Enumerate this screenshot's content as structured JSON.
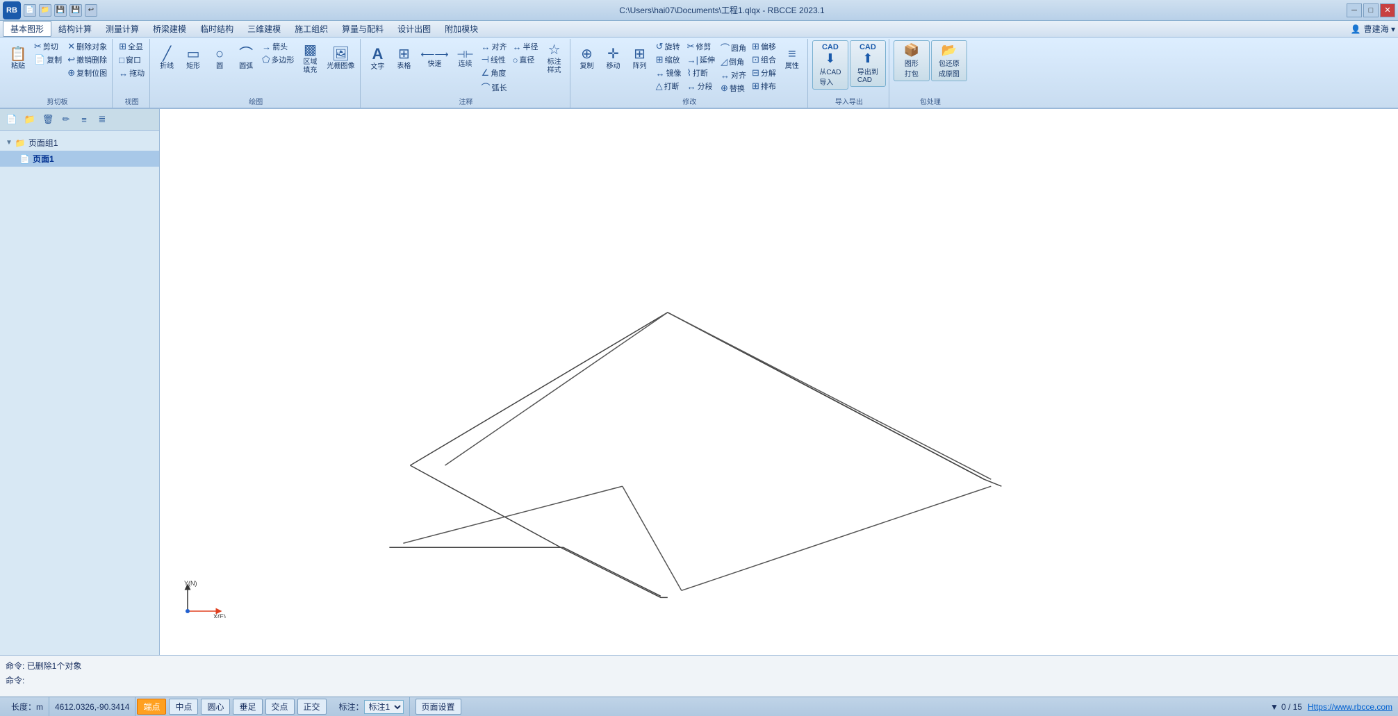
{
  "titlebar": {
    "title": "C:\\Users\\hai07\\Documents\\工程1.qlqx - RBCCE 2023.1",
    "app_name": "RB",
    "minimize": "─",
    "restore": "□",
    "close": "✕"
  },
  "menubar": {
    "items": [
      "基本图形",
      "结构计算",
      "测量计算",
      "桥梁建模",
      "临时结构",
      "三维建模",
      "施工组织",
      "算量与配料",
      "设计出图",
      "附加模块"
    ],
    "active_item": 0,
    "user": "曹建海 ▾"
  },
  "ribbon": {
    "groups": [
      {
        "label": "剪切板",
        "buttons": [
          {
            "icon": "📋",
            "label": "粘贴",
            "type": "big"
          },
          {
            "col": [
              {
                "icon": "✂",
                "label": "剪切"
              },
              {
                "icon": "📄",
                "label": "复制"
              }
            ]
          },
          {
            "col": [
              {
                "icon": "↩",
                "label": "删除对象"
              },
              {
                "icon": "↪",
                "label": "撤销删除"
              },
              {
                "icon": "⊕",
                "label": "复制位图"
              }
            ]
          }
        ]
      },
      {
        "label": "视图",
        "buttons": [
          {
            "col": [
              {
                "icon": "⊞",
                "label": "全显"
              },
              {
                "icon": "□",
                "label": "窗口"
              },
              {
                "icon": "↔",
                "label": "拖动"
              }
            ]
          }
        ]
      },
      {
        "label": "绘图",
        "buttons": [
          {
            "icon": "╱",
            "label": "折线",
            "type": "big"
          },
          {
            "icon": "□",
            "label": "矩形",
            "type": "big"
          },
          {
            "icon": "○",
            "label": "圆",
            "type": "big"
          },
          {
            "icon": "⌒",
            "label": "圆弧",
            "type": "big"
          },
          {
            "col": [
              {
                "icon": "→",
                "label": "箭头"
              },
              {
                "icon": "⬠",
                "label": "多边形"
              }
            ]
          },
          {
            "icon": "▩",
            "label": "区域填充",
            "type": "big"
          },
          {
            "icon": "🖼",
            "label": "光栅图像",
            "type": "big"
          }
        ]
      },
      {
        "label": "注释",
        "buttons": [
          {
            "icon": "A",
            "label": "文字",
            "type": "big"
          },
          {
            "icon": "⊞",
            "label": "表格",
            "type": "big"
          },
          {
            "icon": "⟵⟶",
            "label": "快速",
            "type": "big"
          },
          {
            "icon": "⊣⊢",
            "label": "连续",
            "type": "big"
          },
          {
            "col": [
              {
                "icon": "↔",
                "label": "对齐"
              },
              {
                "icon": "⊣",
                "label": "线性"
              },
              {
                "icon": "∠",
                "label": "角度"
              },
              {
                "icon": "⌒",
                "label": "弧长"
              }
            ]
          },
          {
            "col": [
              {
                "icon": "↔",
                "label": "半径"
              },
              {
                "icon": "○",
                "label": "直径"
              }
            ]
          },
          {
            "icon": "☆",
            "label": "标注样式",
            "type": "big"
          }
        ]
      },
      {
        "label": "修改",
        "buttons": [
          {
            "icon": "⊕",
            "label": "复制",
            "type": "big"
          },
          {
            "icon": "↔",
            "label": "移动",
            "type": "big"
          },
          {
            "icon": "⊞",
            "label": "阵列",
            "type": "big"
          },
          {
            "col": [
              {
                "icon": "↺",
                "label": "旋转"
              },
              {
                "icon": "⊞",
                "label": "缩放"
              },
              {
                "icon": "↔",
                "label": "镜像"
              },
              {
                "icon": "△",
                "label": "打断"
              }
            ]
          },
          {
            "col": [
              {
                "icon": "✂",
                "label": "修剪"
              },
              {
                "icon": "→|",
                "label": "延伸"
              },
              {
                "icon": "△",
                "label": "打断"
              },
              {
                "icon": "↔",
                "label": "分段"
              }
            ]
          },
          {
            "col": [
              {
                "icon": "⌒",
                "label": "圆角"
              },
              {
                "icon": "◿",
                "label": "倒角"
              },
              {
                "icon": "↔",
                "label": "对齐"
              },
              {
                "icon": "⊕",
                "label": "替换"
              }
            ]
          },
          {
            "col": [
              {
                "icon": "⊞",
                "label": "偏移"
              },
              {
                "icon": "⊡",
                "label": "组合"
              },
              {
                "icon": "⊟",
                "label": "分解"
              },
              {
                "icon": "⊞",
                "label": "排布"
              }
            ]
          },
          {
            "icon": "≡",
            "label": "属性",
            "type": "big"
          }
        ]
      },
      {
        "label": "导入导出",
        "buttons": [
          {
            "icon": "CAD\n导入",
            "label": "从CAD\n导入",
            "type": "cad"
          },
          {
            "icon": "CAD\n导出",
            "label": "导出到\nCAD",
            "type": "cad"
          }
        ]
      },
      {
        "label": "包处理",
        "buttons": [
          {
            "icon": "⊡",
            "label": "图形\n打包",
            "type": "cad"
          },
          {
            "icon": "⊞",
            "label": "包还原\n成原图",
            "type": "cad"
          }
        ]
      }
    ]
  },
  "sidebar": {
    "toolbar_btns": [
      "📄",
      "📁",
      "🗑",
      "✏",
      "≡",
      "≣"
    ],
    "tree": [
      {
        "label": "页面组1",
        "level": 0,
        "expanded": true,
        "type": "group"
      },
      {
        "label": "页面1",
        "level": 1,
        "expanded": false,
        "type": "page",
        "active": true
      }
    ]
  },
  "canvas": {
    "coord_label": "Y(N)",
    "coord_x_label": "X(E)"
  },
  "commands": [
    {
      "text": "命令: 已删除1个对象"
    },
    {
      "text": "命令:"
    }
  ],
  "statusbar": {
    "length_label": "长度：m",
    "coords": "4612.0326,-90.3414",
    "snap_btns": [
      {
        "label": "端点",
        "active": true
      },
      {
        "label": "中点",
        "active": false
      },
      {
        "label": "圆心",
        "active": false
      },
      {
        "label": "垂足",
        "active": false
      },
      {
        "label": "交点",
        "active": false
      },
      {
        "label": "正交",
        "active": false
      }
    ],
    "mark_label": "标注：",
    "mark_value": "标注1",
    "page_settings": "页面设置",
    "signal_icon": "▼",
    "count": "0 / 15",
    "website": "Https://www.rbcce.com"
  }
}
